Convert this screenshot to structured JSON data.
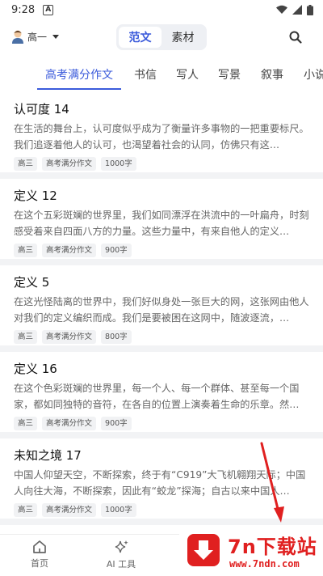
{
  "status_bar": {
    "time": "9:28",
    "notification_icon": "A",
    "icons": [
      "wifi-icon",
      "signal-icon",
      "battery-icon"
    ]
  },
  "header": {
    "grade": "高一",
    "segments": [
      {
        "label": "范文",
        "active": true
      },
      {
        "label": "素材",
        "active": false
      }
    ]
  },
  "tabs": [
    {
      "label": "高考满分作文",
      "active": true
    },
    {
      "label": "书信",
      "active": false
    },
    {
      "label": "写人",
      "active": false
    },
    {
      "label": "写景",
      "active": false
    },
    {
      "label": "叙事",
      "active": false
    },
    {
      "label": "小说",
      "active": false
    }
  ],
  "articles": [
    {
      "title": "认可度 14",
      "excerpt": "在生活的舞台上，认可度似乎成为了衡量许多事物的一把重要标尺。我们追逐着他人的认可，也渴望着社会的认同，仿佛只有这…",
      "tags": [
        "高三",
        "高考满分作文",
        "1000字"
      ]
    },
    {
      "title": "定义 12",
      "excerpt": "在这个五彩斑斓的世界里，我们如同漂浮在洪流中的一叶扁舟，时刻感受着来自四面八方的力量。这些力量中，有来自他人的定义…",
      "tags": [
        "高三",
        "高考满分作文",
        "900字"
      ]
    },
    {
      "title": "定义 5",
      "excerpt": "在这光怪陆离的世界中，我们好似身处一张巨大的网，这张网由他人对我们的定义编织而成。我们是要被困在这网中，随波逐流，…",
      "tags": [
        "高三",
        "高考满分作文",
        "800字"
      ]
    },
    {
      "title": "定义 16",
      "excerpt": "在这个色彩斑斓的世界里，每一个人、每一个群体、甚至每一个国家，都如同独特的音符，在各自的位置上演奏着生命的乐章。然…",
      "tags": [
        "高三",
        "高考满分作文",
        "900字"
      ]
    },
    {
      "title": "未知之境 17",
      "excerpt": "中国人仰望天空，不断探索，终于有“C919”大飞机翱翔天际；中国人向往大海，不断探索，因此有“蛟龙”探海；自古以来中国人…",
      "tags": [
        "高三",
        "高考满分作文",
        "1000字"
      ]
    }
  ],
  "bottom_nav": [
    {
      "label": "首页",
      "icon": "home-icon"
    },
    {
      "label": "AI 工具",
      "icon": "sparkle-icon"
    }
  ],
  "watermark": {
    "title": "7n下载站",
    "url": "www.7ndn.com"
  },
  "colors": {
    "accent": "#3b5bdb",
    "watermark": "#e02020",
    "divider": "#f2f3f5"
  }
}
